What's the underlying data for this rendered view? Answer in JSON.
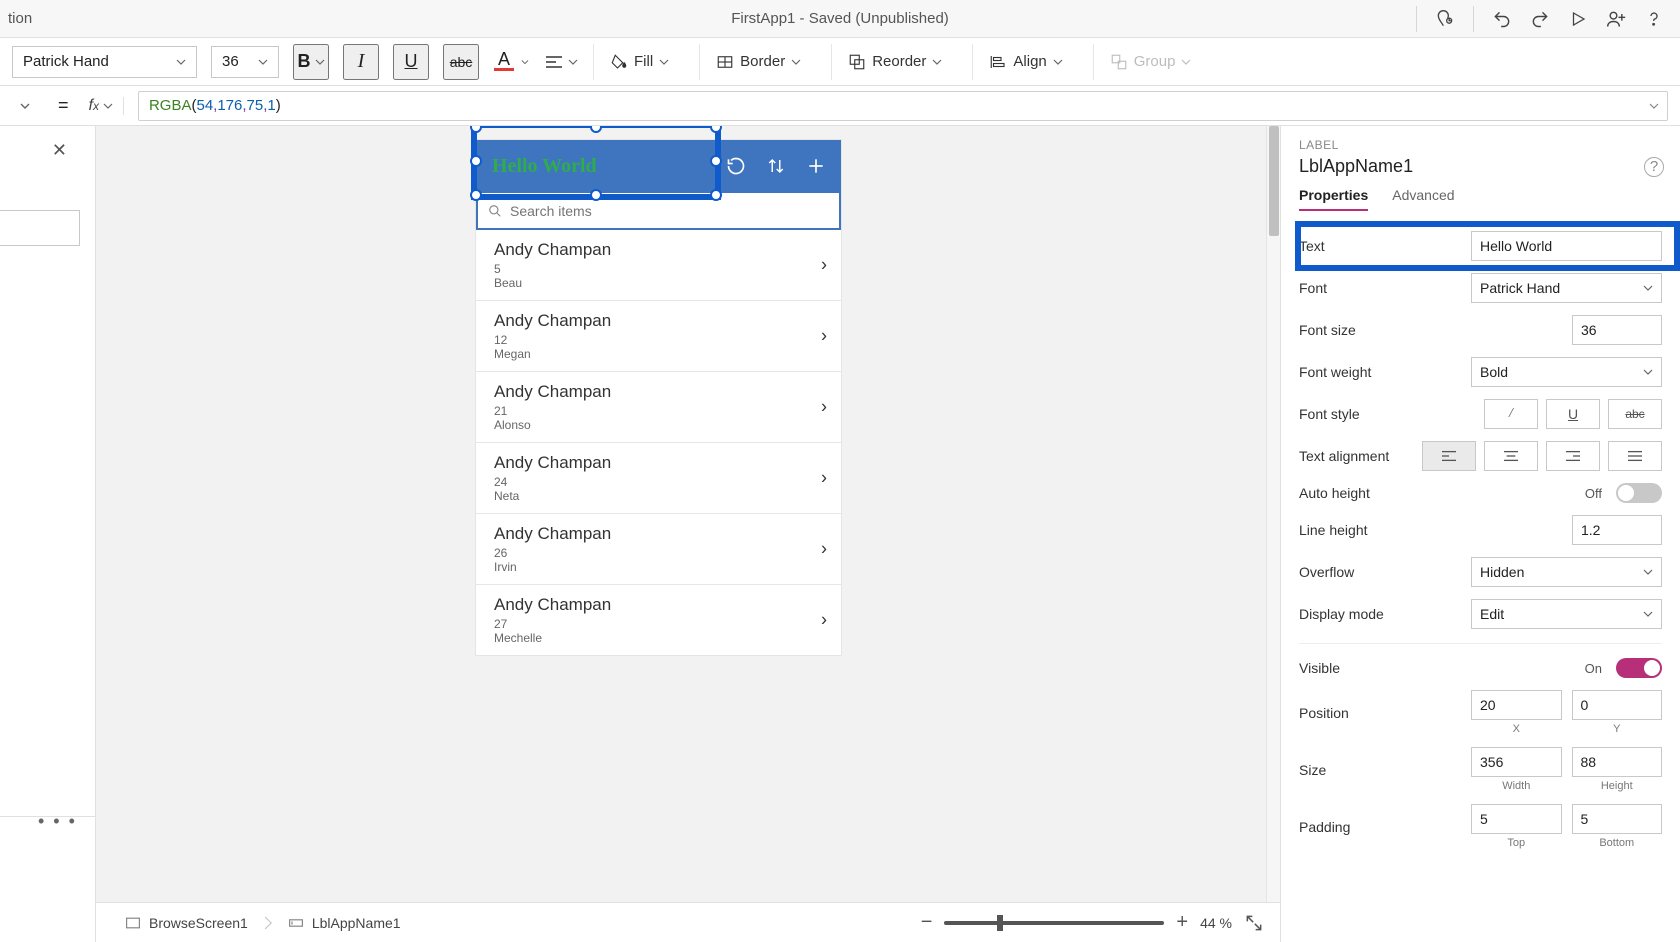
{
  "titlebar": {
    "truncated_left": "tion",
    "title": "FirstApp1 - Saved (Unpublished)"
  },
  "ribbon": {
    "font_name": "Patrick Hand",
    "font_size": "36",
    "fill_label": "Fill",
    "border_label": "Border",
    "reorder_label": "Reorder",
    "align_label": "Align",
    "group_label": "Group"
  },
  "formula": {
    "fn": "RGBA",
    "open": "(",
    "a1": "54",
    "c": ", ",
    "a2": "176",
    "a3": "75",
    "a4": "1",
    "close": ")"
  },
  "canvas": {
    "label_text": "Hello World",
    "search_placeholder": "Search items",
    "rows": [
      {
        "title": "Andy Champan",
        "num": "5",
        "sub": "Beau"
      },
      {
        "title": "Andy Champan",
        "num": "12",
        "sub": "Megan"
      },
      {
        "title": "Andy Champan",
        "num": "21",
        "sub": "Alonso"
      },
      {
        "title": "Andy Champan",
        "num": "24",
        "sub": "Neta"
      },
      {
        "title": "Andy Champan",
        "num": "26",
        "sub": "Irvin"
      },
      {
        "title": "Andy Champan",
        "num": "27",
        "sub": "Mechelle"
      }
    ]
  },
  "footer": {
    "crumb1": "BrowseScreen1",
    "crumb2": "LblAppName1",
    "zoom_pct": "44",
    "zoom_unit": "%"
  },
  "props": {
    "type_label": "LABEL",
    "element_name": "LblAppName1",
    "tabs": {
      "properties": "Properties",
      "advanced": "Advanced"
    },
    "text": {
      "label": "Text",
      "value": "Hello World"
    },
    "font": {
      "label": "Font",
      "value": "Patrick Hand"
    },
    "font_size": {
      "label": "Font size",
      "value": "36"
    },
    "font_weight": {
      "label": "Font weight",
      "value": "Bold"
    },
    "font_style": {
      "label": "Font style"
    },
    "text_align": {
      "label": "Text alignment"
    },
    "auto_height": {
      "label": "Auto height",
      "state": "Off"
    },
    "line_height": {
      "label": "Line height",
      "value": "1.2"
    },
    "overflow": {
      "label": "Overflow",
      "value": "Hidden"
    },
    "display_mode": {
      "label": "Display mode",
      "value": "Edit"
    },
    "visible": {
      "label": "Visible",
      "state": "On"
    },
    "position": {
      "label": "Position",
      "x": "20",
      "y": "0",
      "xlabel": "X",
      "ylabel": "Y"
    },
    "size": {
      "label": "Size",
      "w": "356",
      "h": "88",
      "wlabel": "Width",
      "hlabel": "Height"
    },
    "padding": {
      "label": "Padding",
      "t": "5",
      "b": "5",
      "tlabel": "Top",
      "blabel": "Bottom"
    }
  }
}
